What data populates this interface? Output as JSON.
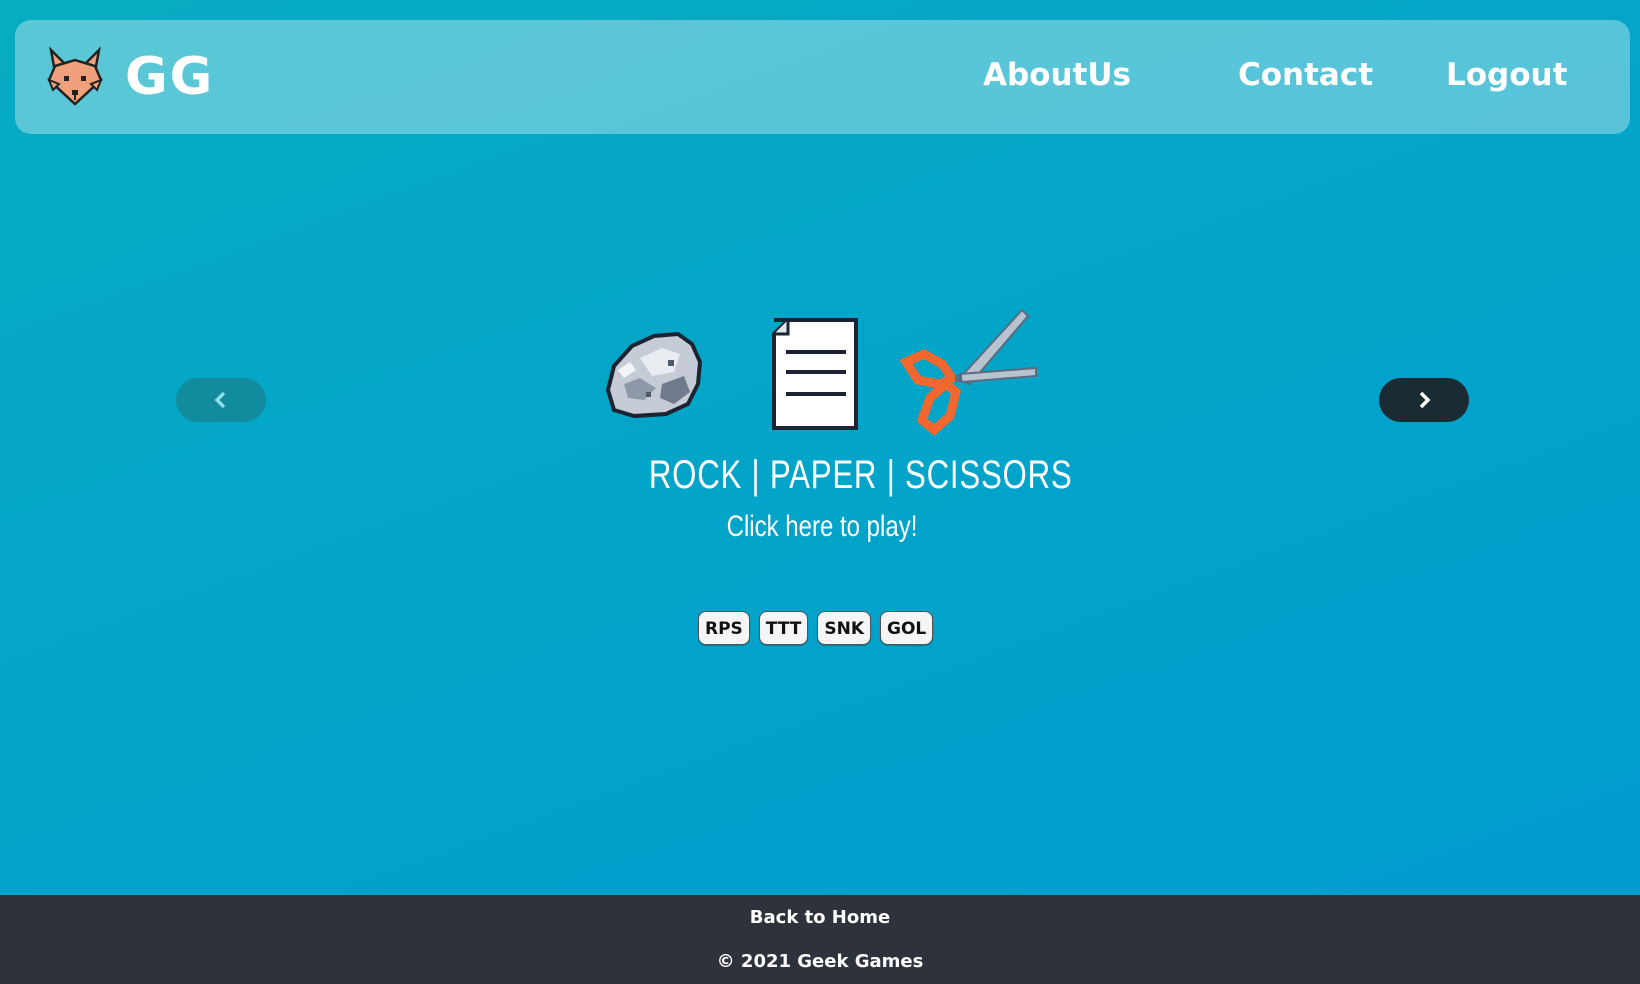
{
  "navbar": {
    "brand": "GG",
    "logo_icon": "fox-head-icon",
    "links": {
      "about": "AboutUs",
      "contact": "Contact",
      "logout": "Logout"
    }
  },
  "carousel": {
    "prev_icon": "chevron-left-icon",
    "next_icon": "chevron-right-icon",
    "active_slide": {
      "title": "ROCK | PAPER | SCISSORS",
      "caption": "Click here to play!",
      "icons": [
        "rock-icon",
        "paper-icon",
        "scissors-icon"
      ]
    }
  },
  "games": [
    "RPS",
    "TTT",
    "SNK",
    "GOL"
  ],
  "footer": {
    "home_link": "Back to Home",
    "copyright": "© 2021 Geek Games"
  },
  "colors": {
    "background_start": "#06acc2",
    "background_end": "#029bd0",
    "navbar_overlay": "rgba(255,255,255,0.34)",
    "prev_button": "#138b9e",
    "next_button": "#1a2b34",
    "footer": "#2e323a",
    "scissor_handles": "#f2672d"
  }
}
